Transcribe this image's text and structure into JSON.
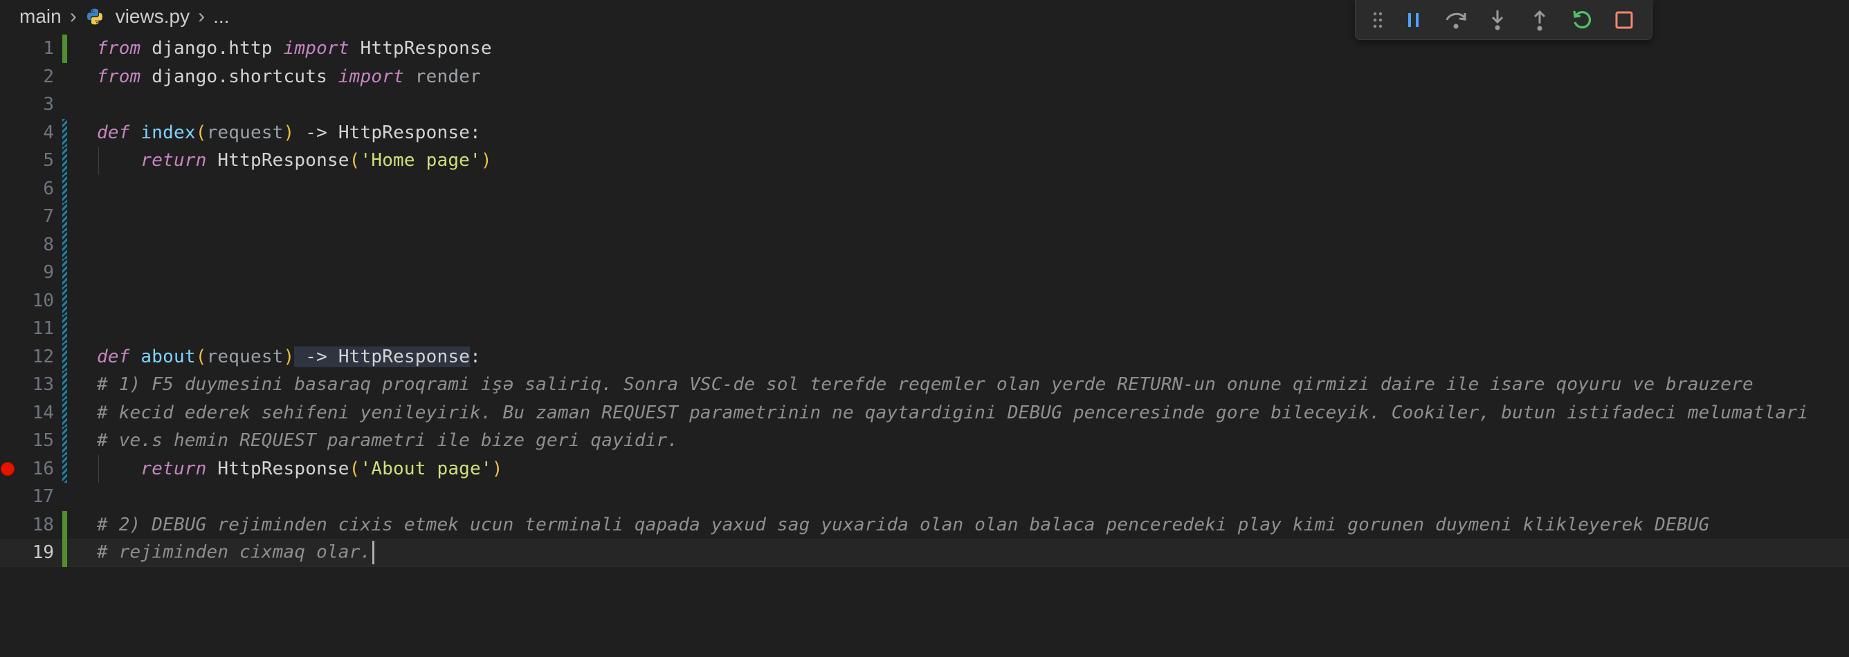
{
  "breadcrumb": {
    "folder": "main",
    "file": "views.py",
    "more": "...",
    "icons": [
      "chevron-right-icon",
      "python-icon"
    ]
  },
  "debug_toolbar": {
    "buttons": [
      "drag-grip-icon",
      "pause-icon",
      "step-over-icon",
      "step-into-icon",
      "step-out-icon",
      "restart-icon",
      "stop-icon"
    ],
    "colors": {
      "pause": "#4aa3ff",
      "restart": "#4fc36a",
      "stop": "#f48771",
      "neutral": "#9a9a9a"
    }
  },
  "code": {
    "lines": [
      {
        "n": "1",
        "t": [
          [
            "kw",
            "from"
          ],
          [
            "cls",
            " django.http "
          ],
          [
            "kw",
            "import"
          ],
          [
            "cls",
            " HttpResponse"
          ]
        ],
        "mark": "added"
      },
      {
        "n": "2",
        "t": [
          [
            "kw",
            "from"
          ],
          [
            "cls",
            " django.shortcuts "
          ],
          [
            "kw",
            "import"
          ],
          [
            "dim",
            " render"
          ]
        ],
        "mark": ""
      },
      {
        "n": "3",
        "t": [],
        "mark": ""
      },
      {
        "n": "4",
        "t": [
          [
            "kw",
            "def"
          ],
          [
            "cls",
            " "
          ],
          [
            "fn",
            "index"
          ],
          [
            "paren",
            "("
          ],
          [
            "param",
            "request"
          ],
          [
            "paren",
            ")"
          ],
          [
            "cls",
            " -> HttpResponse:"
          ]
        ],
        "mark": "modified"
      },
      {
        "n": "5",
        "t": [
          [
            "cls",
            "    "
          ],
          [
            "kw",
            "return"
          ],
          [
            "cls",
            " HttpResponse"
          ],
          [
            "paren",
            "("
          ],
          [
            "str-green",
            "'Home page'"
          ],
          [
            "paren",
            ")"
          ]
        ],
        "mark": "modified",
        "guide": true
      },
      {
        "n": "6",
        "t": [],
        "mark": "modified"
      },
      {
        "n": "7",
        "t": [],
        "mark": "modified"
      },
      {
        "n": "8",
        "t": [],
        "mark": "modified"
      },
      {
        "n": "9",
        "t": [],
        "mark": "modified"
      },
      {
        "n": "10",
        "t": [],
        "mark": "modified"
      },
      {
        "n": "11",
        "t": [],
        "mark": "modified"
      },
      {
        "n": "12",
        "t": [
          [
            "kw",
            "def"
          ],
          [
            "cls",
            " "
          ],
          [
            "fn",
            "about"
          ],
          [
            "paren",
            "("
          ],
          [
            "param",
            "request"
          ],
          [
            "paren",
            ")"
          ],
          [
            "sel-hl",
            " -> HttpResponse"
          ],
          [
            "cls",
            ":"
          ]
        ],
        "mark": "modified"
      },
      {
        "n": "13",
        "t": [
          [
            "cmt",
            "# 1) F5 duymesini basaraq proqrami işə saliriq. Sonra VSC-de sol terefde reqemler olan yerde RETURN-un onune qirmizi daire ile isare qoyuru ve brauzere"
          ]
        ],
        "mark": "modified"
      },
      {
        "n": "14",
        "t": [
          [
            "cmt",
            "# kecid ederek sehifeni yenileyirik. Bu zaman REQUEST parametrinin ne qaytardigini DEBUG penceresinde gore bileceyik. Cookiler, butun istifadeci melumatlari"
          ]
        ],
        "mark": "modified"
      },
      {
        "n": "15",
        "t": [
          [
            "cmt",
            "# ve.s hemin REQUEST parametri ile bize geri qayidir."
          ]
        ],
        "mark": "modified"
      },
      {
        "n": "16",
        "t": [
          [
            "cls",
            "    "
          ],
          [
            "kw",
            "return"
          ],
          [
            "cls",
            " HttpResponse"
          ],
          [
            "paren",
            "("
          ],
          [
            "str-green",
            "'About page'"
          ],
          [
            "paren",
            ")"
          ]
        ],
        "mark": "modified",
        "breakpoint": true,
        "guide": true
      },
      {
        "n": "17",
        "t": [],
        "mark": ""
      },
      {
        "n": "18",
        "t": [
          [
            "cmt",
            "# 2) DEBUG rejiminden cixis etmek ucun terminali qapada yaxud sag yuxarida olan olan balaca penceredeki play kimi gorunen duymeni klikleyerek DEBUG"
          ]
        ],
        "mark": "added"
      },
      {
        "n": "19",
        "t": [
          [
            "cmt",
            "# rejiminden cixmaq olar."
          ]
        ],
        "mark": "added",
        "current": true
      }
    ]
  }
}
